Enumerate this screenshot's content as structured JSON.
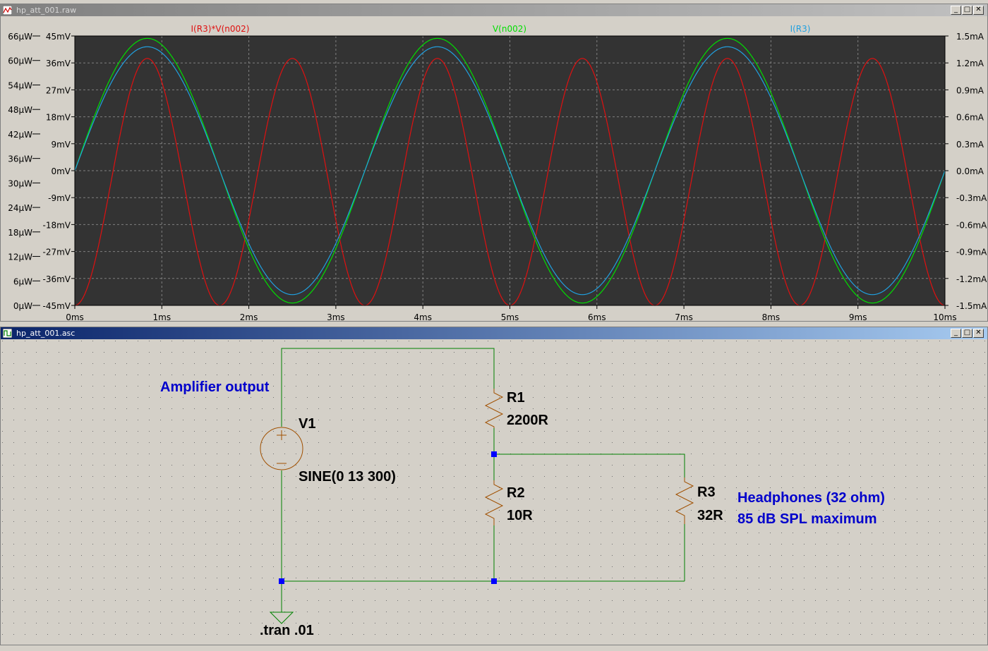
{
  "colors": {
    "plot_bg": "#333333",
    "grid": "#808080",
    "power_trace": "#e01010",
    "voltage_trace": "#00e000",
    "current_trace": "#20a0e0",
    "wire": "#008000",
    "node": "#0000ff",
    "component": "#a05000",
    "comment": "#0000cc",
    "schematic_bg": "#d4d0c8"
  },
  "waveform_window": {
    "title": "hp_att_001.raw",
    "buttons": {
      "minimize": "_",
      "maximize": "□",
      "close": "✕"
    }
  },
  "schematic_window": {
    "title": "hp_att_001.asc",
    "buttons": {
      "minimize": "_",
      "maximize": "□",
      "close": "✕"
    }
  },
  "chart_data": {
    "type": "line",
    "x": {
      "label": "",
      "range_ms": [
        0,
        10
      ],
      "tick_labels": [
        "0ms",
        "1ms",
        "2ms",
        "3ms",
        "4ms",
        "5ms",
        "6ms",
        "7ms",
        "8ms",
        "9ms",
        "10ms"
      ]
    },
    "axes": {
      "left_power": {
        "range": [
          0,
          66
        ],
        "unit": "µW",
        "tick_labels": [
          "66µW",
          "60µW",
          "54µW",
          "48µW",
          "42µW",
          "36µW",
          "30µW",
          "24µW",
          "18µW",
          "12µW",
          "6µW",
          "0µW"
        ]
      },
      "left_voltage": {
        "range": [
          -45,
          45
        ],
        "unit": "mV",
        "tick_labels": [
          "45mV",
          "36mV",
          "27mV",
          "18mV",
          "9mV",
          "0mV",
          "-9mV",
          "-18mV",
          "-27mV",
          "-36mV",
          "-45mV"
        ]
      },
      "right_current": {
        "range": [
          -1.5,
          1.5
        ],
        "unit": "mA",
        "tick_labels": [
          "1.5mA",
          "1.2mA",
          "0.9mA",
          "0.6mA",
          "0.3mA",
          "0.0mA",
          "-0.3mA",
          "-0.6mA",
          "-0.9mA",
          "-1.2mA",
          "-1.5mA"
        ]
      }
    },
    "grid": true,
    "series": [
      {
        "name": "I(R3)*V(n002)",
        "axis": "left_power",
        "shape": "sin^2",
        "frequency_hz": 300,
        "peak": 60.5,
        "color_key": "power_trace"
      },
      {
        "name": "V(n002)",
        "axis": "left_voltage",
        "shape": "sine",
        "frequency_hz": 300,
        "amplitude": 44.2,
        "color_key": "voltage_trace"
      },
      {
        "name": "I(R3)",
        "axis": "right_current",
        "shape": "sine",
        "frequency_hz": 300,
        "amplitude": 1.38,
        "color_key": "current_trace"
      }
    ]
  },
  "schematic": {
    "components": {
      "v1": {
        "name": "V1",
        "value": "SINE(0 13 300)"
      },
      "r1": {
        "name": "R1",
        "value": "2200R"
      },
      "r2": {
        "name": "R2",
        "value": "10R"
      },
      "r3": {
        "name": "R3",
        "value": "32R"
      }
    },
    "comments": {
      "amplifier": "Amplifier output",
      "headphones_line1": "Headphones (32 ohm)",
      "headphones_line2": "85 dB SPL maximum"
    },
    "directive": ".tran .01"
  }
}
